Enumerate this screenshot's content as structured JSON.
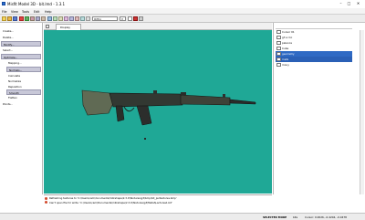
{
  "window": {
    "title": "Misfit Model 3D - bit.lmd - 1.3.1",
    "minimize": "–",
    "maximize": "□",
    "close": "✕"
  },
  "menu": [
    "File",
    "View",
    "Tools",
    "Edit",
    "Help"
  ],
  "toolbar": {
    "view_select": "Ortho",
    "snap_select": "V"
  },
  "nav": [
    {
      "label": "Create..."
    },
    {
      "label": "Delete..."
    },
    {
      "label": "Modify..."
    },
    {
      "label": "Select..."
    },
    {
      "label": "Optimize..."
    },
    {
      "label": "Mapping..."
    },
    {
      "label": "Normals..."
    },
    {
      "label": "Calculate"
    },
    {
      "label": "Normalize"
    },
    {
      "label": "Reposition"
    },
    {
      "label": "Smooth"
    },
    {
      "label": "Flatten"
    },
    {
      "label": "Points..."
    }
  ],
  "viewport": {
    "tab_label": "Display",
    "background": "#1fa896"
  },
  "parts": [
    {
      "name": "Cursor 01"
    },
    {
      "name": "g3 a mc"
    },
    {
      "name": "palanca"
    },
    {
      "name": "Cube"
    },
    {
      "name": "geometry"
    },
    {
      "name": "mefa"
    },
    {
      "name": "mony"
    }
  ],
  "log": [
    "Refreshing textures to 'C:\\Users\\cam\\documents\\milkshape\\2.3.0\\Textures\\g3\\bmp\\bit_pultextures.bmp'",
    "Can't open file for write: 'C:\\Users\\cam\\Documents\\milkshape\\2.3.0\\Textures\\g3\\Metal\\Lactures1.bit'"
  ],
  "status": {
    "mode": "SELECTED MODE",
    "extra": "bits",
    "coords": "Cursor: 0.0026, -0.4204, -0.0478"
  },
  "colors": {
    "viewport": "#1fa896",
    "selection": "#2f6ac4"
  }
}
